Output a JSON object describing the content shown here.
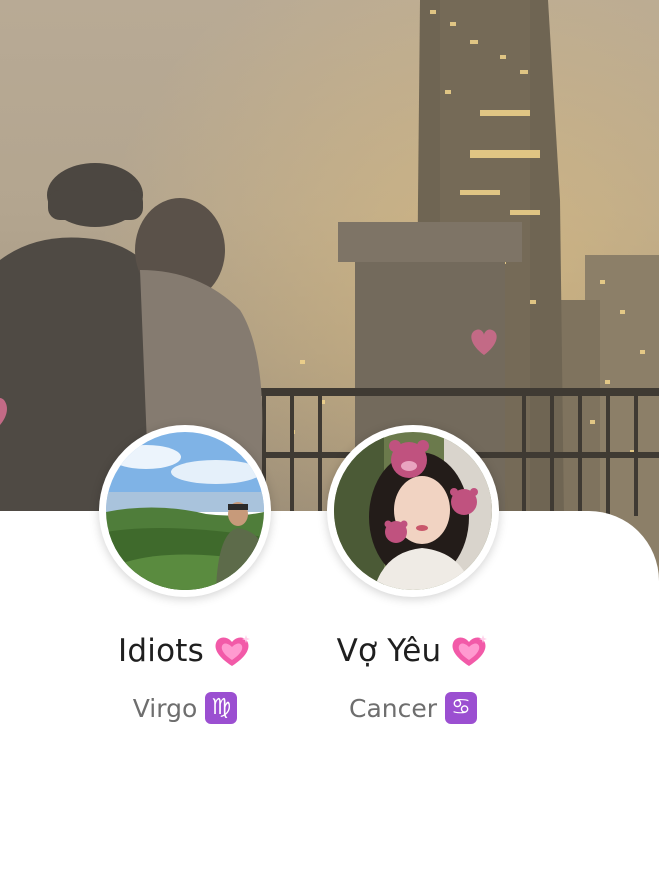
{
  "couple": [
    {
      "name": "Idiots",
      "sign": "Virgo",
      "zodiac_symbol": "♍",
      "heart_icon": "pink-sparkle-heart"
    },
    {
      "name": "Vợ Yêu",
      "sign": "Cancer",
      "zodiac_symbol": "♋",
      "heart_icon": "pink-sparkle-heart"
    }
  ],
  "colors": {
    "zodiac_badge": "#9b4fd1",
    "heart": "#f25aa8",
    "card": "#ffffff"
  }
}
